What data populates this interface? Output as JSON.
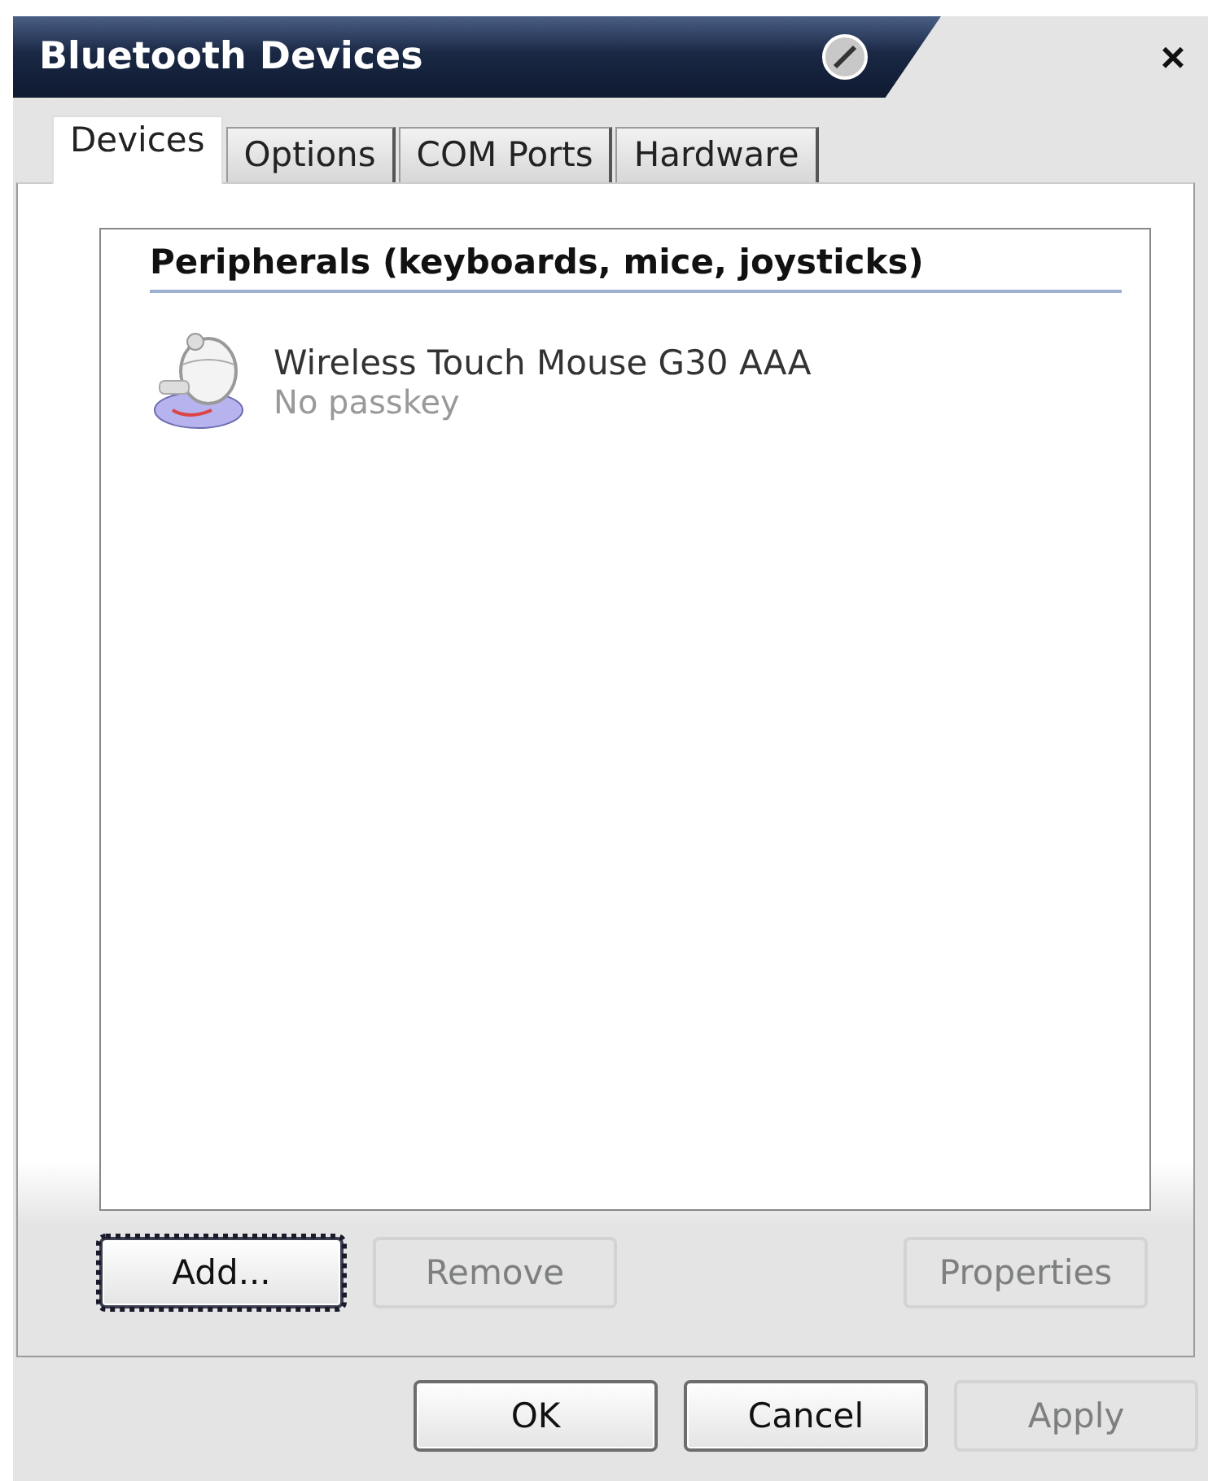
{
  "window": {
    "title": "Bluetooth Devices",
    "close": "×"
  },
  "tabs": [
    {
      "label": "Devices",
      "selected": true
    },
    {
      "label": "Options",
      "selected": false
    },
    {
      "label": "COM Ports",
      "selected": false
    },
    {
      "label": "Hardware",
      "selected": false
    }
  ],
  "device_list": {
    "group_header": "Peripherals (keyboards, mice, joysticks)",
    "devices": [
      {
        "name": "Wireless Touch Mouse G30 AAA",
        "status": "No passkey"
      }
    ]
  },
  "panel_buttons": [
    {
      "label": "Add...",
      "disabled": false,
      "default": true
    },
    {
      "label": "Remove",
      "disabled": true,
      "default": false
    },
    {
      "label": "Properties",
      "disabled": true,
      "default": false
    }
  ],
  "dialog_buttons": [
    {
      "label": "OK",
      "disabled": false
    },
    {
      "label": "Cancel",
      "disabled": false
    },
    {
      "label": "Apply",
      "disabled": true
    }
  ]
}
